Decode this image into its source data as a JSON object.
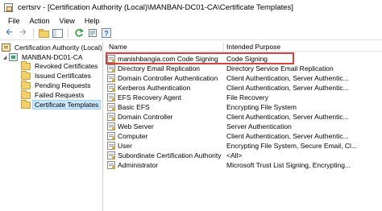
{
  "window": {
    "title": "certsrv - [Certification Authority (Local)\\MANBAN-DC01-CA\\Certificate Templates]"
  },
  "menu": [
    "File",
    "Action",
    "View",
    "Help"
  ],
  "toolbar": {
    "buttons": [
      "back-arrow-icon",
      "forward-arrow-icon",
      "up-folder-icon",
      "show-hide-tree-icon",
      "refresh-icon",
      "export-list-icon",
      "help-icon"
    ]
  },
  "tree": {
    "root": "Certification Authority (Local)",
    "ca": "MANBAN-DC01-CA",
    "folders": [
      "Revoked Certificates",
      "Issued Certificates",
      "Pending Requests",
      "Failed Requests",
      "Certificate Templates"
    ],
    "selected": "Certificate Templates"
  },
  "list": {
    "columns": [
      "Name",
      "Intended Purpose"
    ],
    "rows": [
      {
        "name": "manishbangia.com Code Signing",
        "purpose": "Code Signing"
      },
      {
        "name": "Directory Email Replication",
        "purpose": "Directory Service Email Replication"
      },
      {
        "name": "Domain Controller Authentication",
        "purpose": "Client Authentication, Server Authentic..."
      },
      {
        "name": "Kerberos Authentication",
        "purpose": "Client Authentication, Server Authentic..."
      },
      {
        "name": "EFS Recovery Agent",
        "purpose": "File Recovery"
      },
      {
        "name": "Basic EFS",
        "purpose": "Encrypting File System"
      },
      {
        "name": "Domain Controller",
        "purpose": "Client Authentication, Server Authentic..."
      },
      {
        "name": "Web Server",
        "purpose": "Server Authentication"
      },
      {
        "name": "Computer",
        "purpose": "Client Authentication, Server Authentic..."
      },
      {
        "name": "User",
        "purpose": "Encrypting File System, Secure Email, Cl..."
      },
      {
        "name": "Subordinate Certification Authority",
        "purpose": "<All>"
      },
      {
        "name": "Administrator",
        "purpose": "Microsoft Trust List Signing, Encrypting..."
      }
    ],
    "highlighted_row": "manishbangia.com Code Signing",
    "highlight_color": "#d9403a"
  },
  "colors": {
    "selection": "#cce8ff",
    "folder": "#f1cf6b"
  }
}
